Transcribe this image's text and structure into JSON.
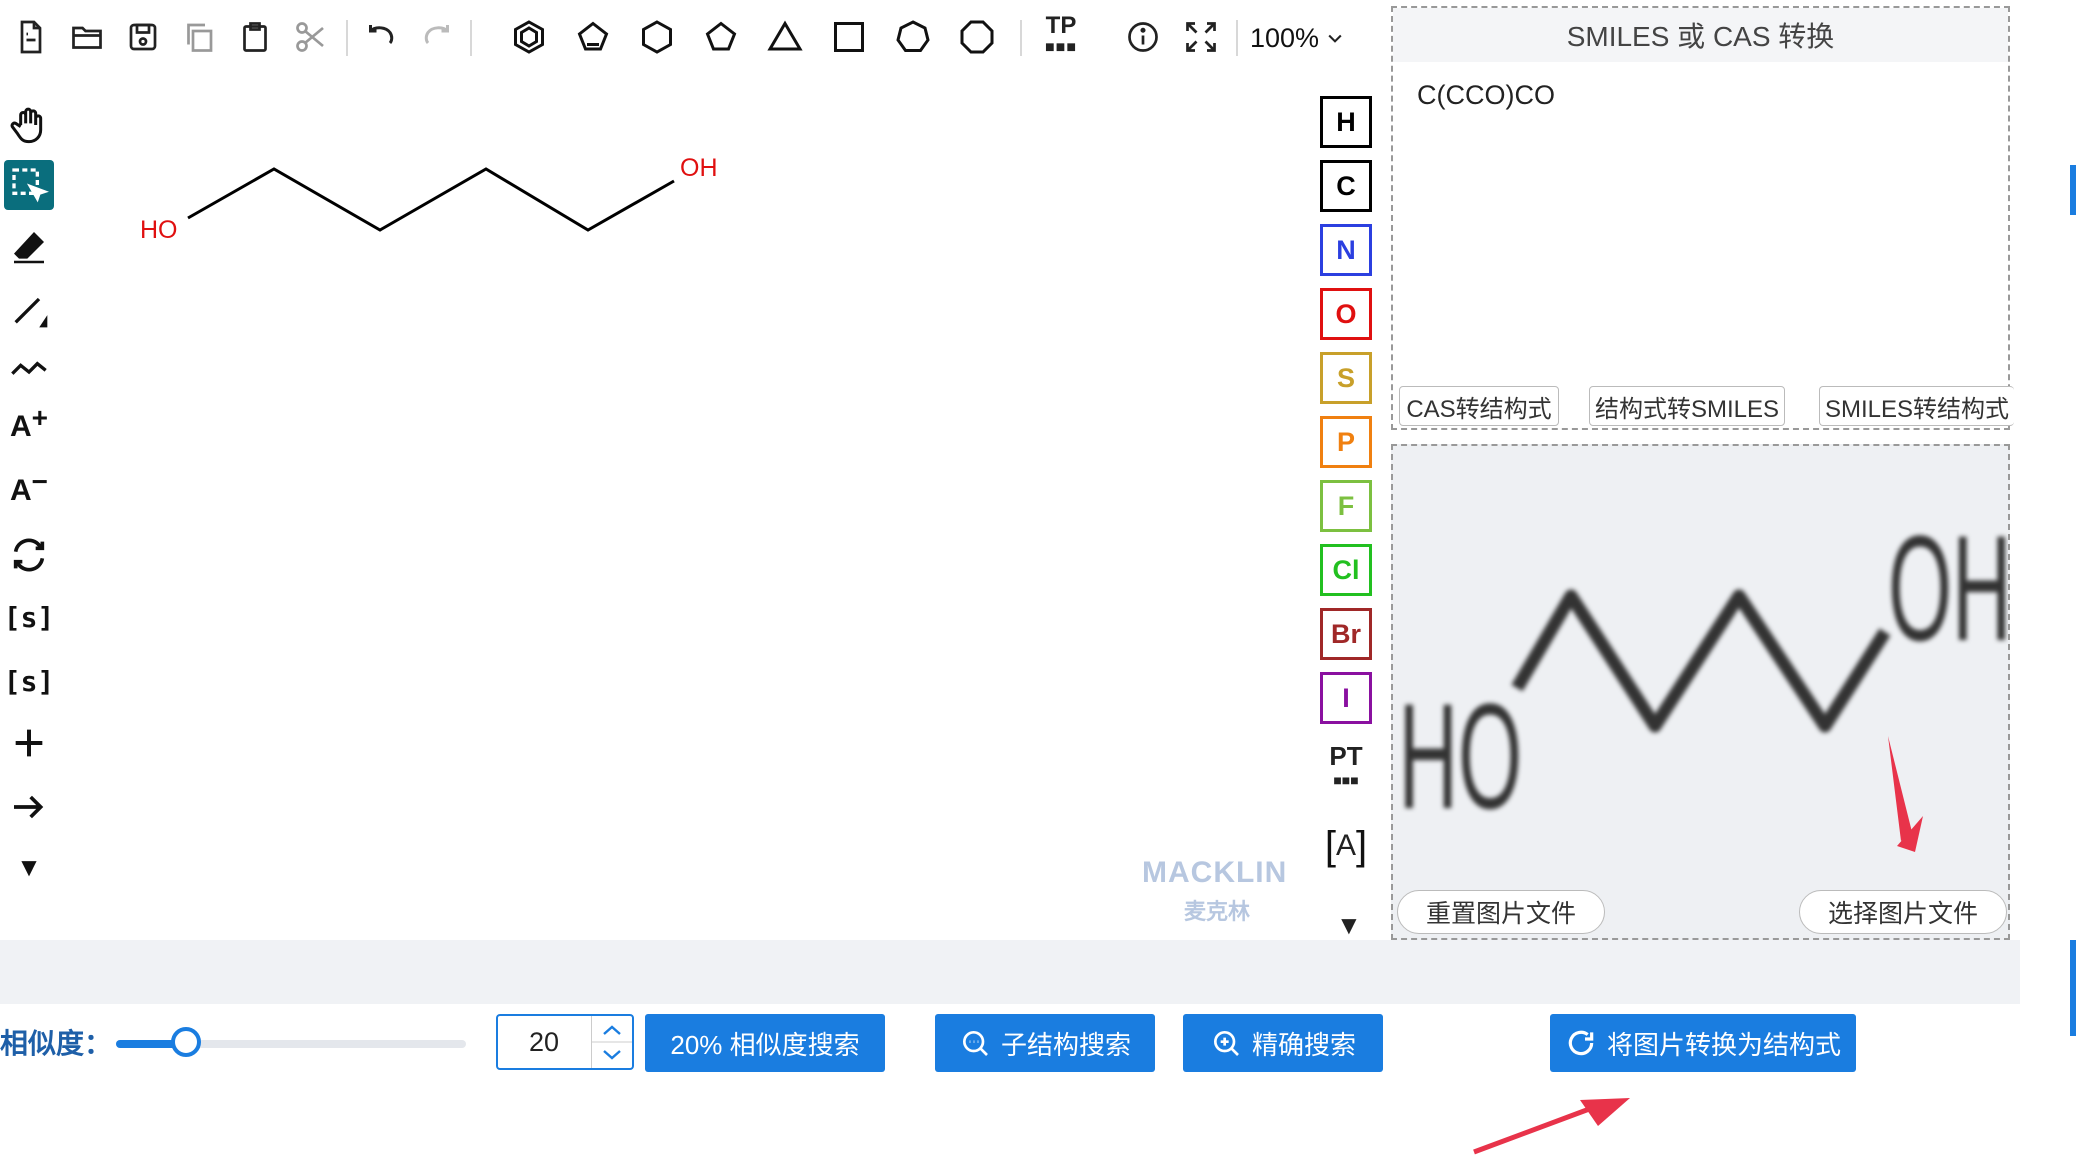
{
  "toolbar": {
    "zoom": "100%",
    "template_label": "TP"
  },
  "left_tools": {
    "text_plus": "A",
    "text_minus": "A",
    "sgroup": "[s]",
    "sgroup_add": "[s]"
  },
  "canvas": {
    "molecule_labels": [
      "HO",
      "OH"
    ],
    "watermark_brand": "MACKLIN",
    "watermark_cn": "麦克林"
  },
  "elements": [
    {
      "symbol": "H",
      "color": "#000000"
    },
    {
      "symbol": "C",
      "color": "#000000"
    },
    {
      "symbol": "N",
      "color": "#2b3fe0"
    },
    {
      "symbol": "O",
      "color": "#e01010"
    },
    {
      "symbol": "S",
      "color": "#c8a02a"
    },
    {
      "symbol": "P",
      "color": "#f08010"
    },
    {
      "symbol": "F",
      "color": "#7cc040"
    },
    {
      "symbol": "Cl",
      "color": "#22c020"
    },
    {
      "symbol": "Br",
      "color": "#a02828"
    },
    {
      "symbol": "I",
      "color": "#8a10a0"
    }
  ],
  "periodic_table_label": "PT",
  "atom_label_tool": "A",
  "smiles_panel": {
    "title": "SMILES 或 CAS 转换",
    "value": "C(CCO)CO",
    "buttons": [
      "CAS转结构式",
      "结构式转SMILES",
      "SMILES转结构式"
    ]
  },
  "image_panel": {
    "labels": [
      "HO",
      "OH"
    ],
    "reset_button": "重置图片文件",
    "select_button": "选择图片文件"
  },
  "search": {
    "similarity_label": "相似度：",
    "similarity_value": "20",
    "similarity_fraction": 0.2,
    "similarity_button": "20% 相似度搜索",
    "substructure_button": "子结构搜索",
    "exact_button": "精确搜索",
    "convert_button": "将图片转换为结构式"
  },
  "colors": {
    "accent": "#1a7de0",
    "heteroatom": "#e01010",
    "active_tool": "#0a6e7d",
    "annotation_arrow": "#e8334a"
  }
}
